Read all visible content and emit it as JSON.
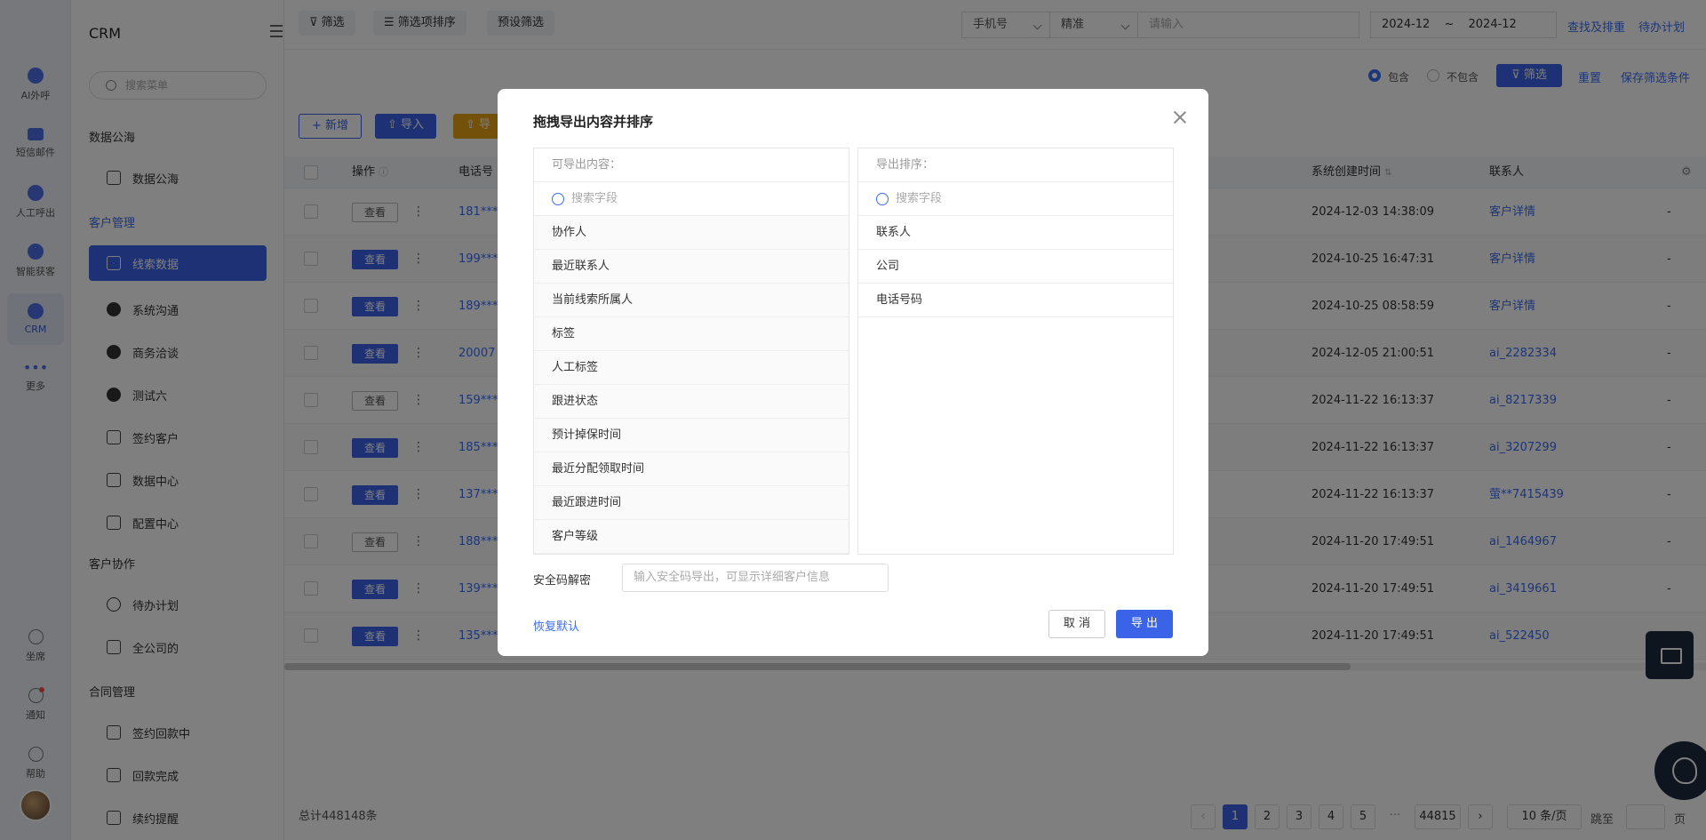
{
  "app": {
    "title": "CRM"
  },
  "rail": {
    "items": [
      {
        "label": "AI外呼",
        "icon": "robot-icon"
      },
      {
        "label": "短信邮件",
        "icon": "message-icon"
      },
      {
        "label": "人工呼出",
        "icon": "call-icon"
      },
      {
        "label": "智能获客",
        "icon": "target-icon"
      },
      {
        "label": "CRM",
        "icon": "crm-icon"
      },
      {
        "label": "更多",
        "icon": "more-icon"
      }
    ],
    "bottom": [
      {
        "label": "坐席",
        "icon": "headset-icon"
      },
      {
        "label": "通知",
        "icon": "bell-icon"
      },
      {
        "label": "帮助",
        "icon": "help-icon"
      }
    ]
  },
  "sidebar": {
    "search_placeholder": "搜索菜单",
    "groups": {
      "g1": "数据公海",
      "g2": "客户管理",
      "g3": "客户协作",
      "g4": "合同管理"
    },
    "items": {
      "data_sea": "数据公海",
      "leads": "线索数据",
      "system_comm": "系统沟通",
      "business": "商务洽谈",
      "test6": "测试六",
      "signed": "签约客户",
      "data_center": "数据中心",
      "config_center": "配置中心",
      "todo": "待办计划",
      "company": "全公司的",
      "refund_pending": "签约回款中",
      "refund_done": "回款完成",
      "renew": "续约提醒"
    }
  },
  "toolbar": {
    "filter": "筛选",
    "filter_sort": "筛选项排序",
    "preset": "预设筛选",
    "field_select": "手机号",
    "match_select": "精准",
    "search_placeholder": "请输入",
    "date_from": "2024-12",
    "date_sep": "~",
    "date_to": "2024-12",
    "dedupe_link": "查找及排重",
    "todo_link": "待办计划",
    "include": "包含",
    "exclude": "不包含",
    "filter_btn": "筛选",
    "reset": "重置",
    "save_filter": "保存筛选条件",
    "add": "+ 新增",
    "import": "导入",
    "export_partial": "导"
  },
  "table": {
    "headers": {
      "op": "操作",
      "phone": "电话号",
      "created": "系统创建时间",
      "contact": "联系人"
    },
    "view_label": "查看",
    "rows": [
      {
        "phone": "181***",
        "time": "2024-12-03 14:38:09",
        "contact": "客户详情",
        "extra": "-",
        "solid": false
      },
      {
        "phone": "199***",
        "time": "2024-10-25 16:47:31",
        "contact": "客户详情",
        "extra": "-",
        "solid": true
      },
      {
        "phone": "189***",
        "time": "2024-10-25 08:58:59",
        "contact": "客户详情",
        "extra": "-",
        "solid": true
      },
      {
        "phone": "20007",
        "time": "2024-12-05 21:00:51",
        "contact": "ai_2282334",
        "extra": "-",
        "solid": true
      },
      {
        "phone": "159***",
        "time": "2024-11-22 16:13:37",
        "contact": "ai_8217339",
        "extra": "-",
        "solid": false
      },
      {
        "phone": "185***",
        "time": "2024-11-22 16:13:37",
        "contact": "ai_3207299",
        "extra": "-",
        "solid": true
      },
      {
        "phone": "137***",
        "time": "2024-11-22 16:13:37",
        "contact": "萤**7415439",
        "extra": "-",
        "solid": true
      },
      {
        "phone": "188***",
        "time": "2024-11-20 17:49:51",
        "contact": "ai_1464967",
        "extra": "-",
        "solid": false
      },
      {
        "phone": "139***",
        "time": "2024-11-20 17:49:51",
        "contact": "ai_3419661",
        "extra": "-",
        "solid": true
      },
      {
        "phone": "135***",
        "time": "2024-11-20 17:49:51",
        "contact": "ai_522450",
        "extra": "-",
        "solid": true
      }
    ]
  },
  "footer": {
    "total": "总计448148条",
    "pages": [
      "1",
      "2",
      "3",
      "4",
      "5"
    ],
    "ellipsis": "···",
    "last_page": "44815",
    "page_size": "10 条/页",
    "jump": "跳至",
    "page_unit": "页"
  },
  "modal": {
    "title": "拖拽导出内容并排序",
    "left_head": "可导出内容：",
    "right_head": "导出排序：",
    "search_placeholder": "搜索字段",
    "left_items": [
      "协作人",
      "最近联系人",
      "当前线索所属人",
      "标签",
      "人工标签",
      "跟进状态",
      "预计掉保时间",
      "最近分配领取时间",
      "最近跟进时间",
      "客户等级"
    ],
    "right_items": [
      "联系人",
      "公司",
      "电话号码"
    ],
    "security_label": "安全码解密",
    "security_placeholder": "输入安全码导出，可显示详细客户信息",
    "restore": "恢复默认",
    "cancel": "取 消",
    "export": "导 出"
  },
  "colors": {
    "accent": "#3a63e8",
    "link": "#3a6cf0",
    "export_btn": "#e8a317",
    "rail_bg": "#eef1f7"
  }
}
